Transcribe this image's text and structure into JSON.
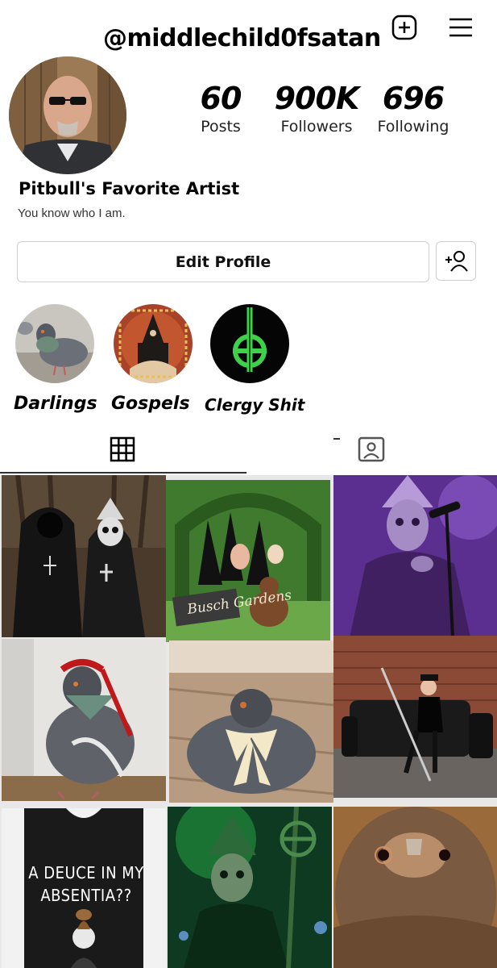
{
  "header": {
    "username": "@middlechild0fsatan"
  },
  "stats": {
    "posts_count": "60",
    "posts_label": "Posts",
    "followers_count": "900K",
    "followers_label": "Followers",
    "following_count": "696",
    "following_label": "Following"
  },
  "bio": {
    "name": "Pitbull's Favorite Artist",
    "text": "You know who I am."
  },
  "actions": {
    "edit_profile_label": "Edit Profile"
  },
  "highlights": [
    {
      "label": "Darlings"
    },
    {
      "label": "Gospels"
    },
    {
      "label": "Clergy Shit"
    }
  ],
  "posts": {
    "shirt_text": "A DEUCE IN MY ABSENTIA??",
    "busch_sign": "Busch Gardens"
  },
  "colors": {
    "text": "#000000",
    "border": "#cfcfcf",
    "background": "#ffffff"
  },
  "icons": [
    "new-post-icon",
    "menu-icon",
    "add-person-icon",
    "grid-icon",
    "tagged-icon"
  ]
}
